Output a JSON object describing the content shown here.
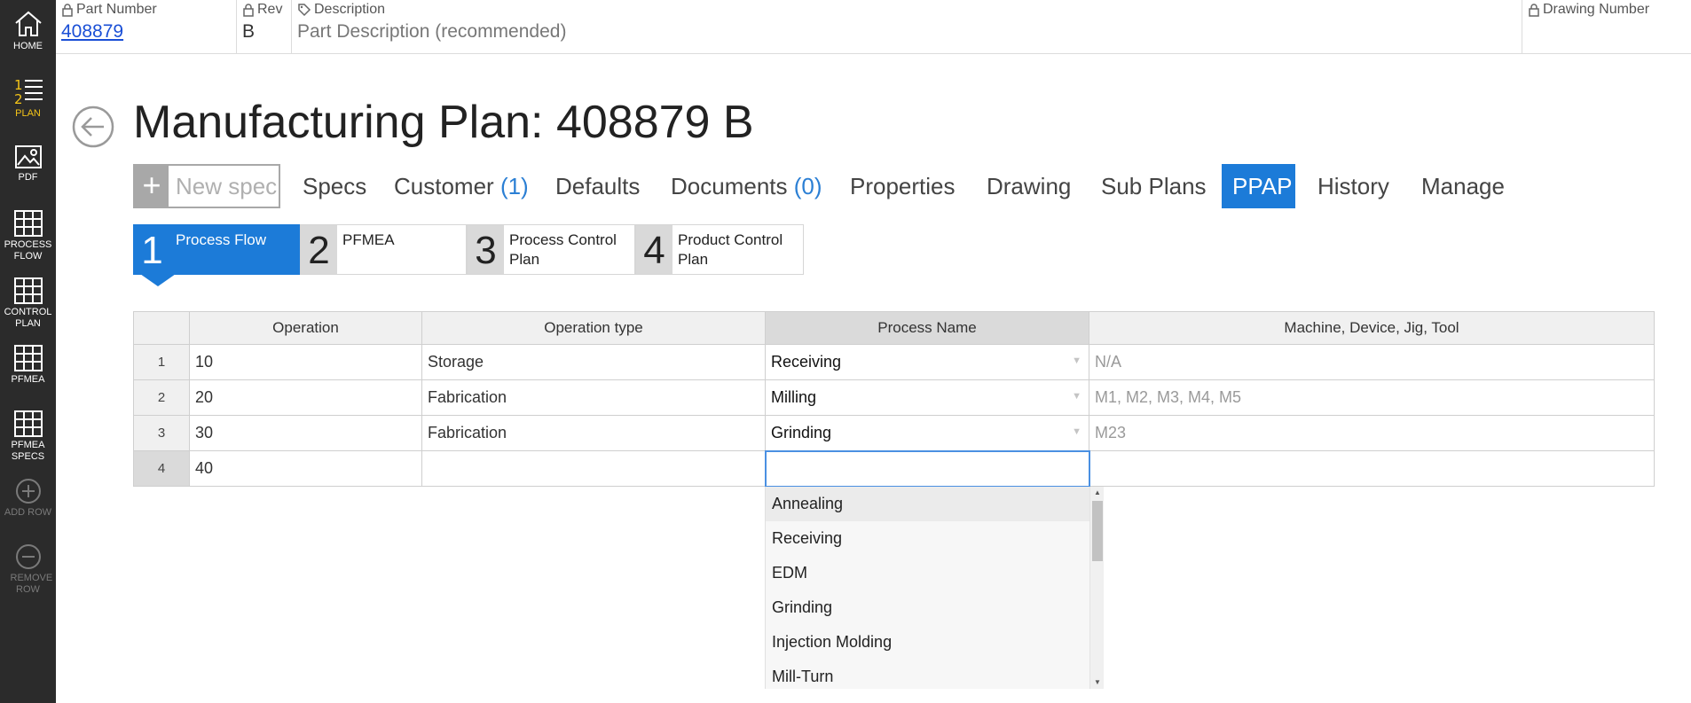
{
  "sidebar": {
    "home": "HOME",
    "plan": "PLAN",
    "pdf": "PDF",
    "process_flow": "PROCESS FLOW",
    "control_plan": "CONTROL PLAN",
    "pfmea": "PFMEA",
    "pfmea_specs": "PFMEA SPECS",
    "add_row": "ADD ROW",
    "remove_row": "REMOVE ROW",
    "icons": [
      "home-icon",
      "numbered-list-icon",
      "image-icon",
      "grid-icon",
      "plus-circle-icon",
      "minus-circle-icon"
    ],
    "accent_color": "#f5c518"
  },
  "header": {
    "part_number_label": "Part Number",
    "part_number": "408879",
    "rev_label": "Rev",
    "rev": "B",
    "description_label": "Description",
    "description_placeholder": "Part Description (recommended)",
    "drawing_number_label": "Drawing Number",
    "rev2_label": "Re"
  },
  "title": "Manufacturing Plan: 408879 B",
  "toolbar": {
    "new_spec_placeholder": "New spec",
    "tabs": {
      "specs": "Specs",
      "customer": "Customer",
      "customer_count": "(1)",
      "defaults": "Defaults",
      "documents": "Documents",
      "documents_count": "(0)",
      "properties": "Properties",
      "drawing": "Drawing",
      "sub_plans": "Sub Plans",
      "ppap": "PPAP",
      "history": "History",
      "manage": "Manage"
    },
    "active_color": "#1c7bd8"
  },
  "steps": [
    {
      "num": "1",
      "label": "Process Flow"
    },
    {
      "num": "2",
      "label": "PFMEA"
    },
    {
      "num": "3",
      "label": "Process Control Plan"
    },
    {
      "num": "4",
      "label": "Product Control Plan"
    }
  ],
  "table": {
    "columns": [
      "Operation",
      "Operation type",
      "Process Name",
      "Machine, Device, Jig, Tool"
    ],
    "rows": [
      {
        "n": "1",
        "operation": "10",
        "type": "Storage",
        "process": "Receiving",
        "machine": "N/A"
      },
      {
        "n": "2",
        "operation": "20",
        "type": "Fabrication",
        "process": "Milling",
        "machine": "M1, M2, M3, M4, M5"
      },
      {
        "n": "3",
        "operation": "30",
        "type": "Fabrication",
        "process": "Grinding",
        "machine": "M23"
      },
      {
        "n": "4",
        "operation": "40",
        "type": "",
        "process": "",
        "machine": ""
      }
    ]
  },
  "dropdown": {
    "options": [
      "Annealing",
      "Receiving",
      "EDM",
      "Grinding",
      "Injection Molding",
      "Mill-Turn"
    ]
  }
}
